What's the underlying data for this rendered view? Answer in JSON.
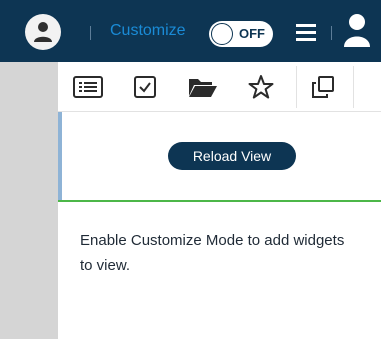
{
  "header": {
    "customize_label": "Customize",
    "toggle_state": "OFF",
    "colors": {
      "bar": "#0d3553",
      "accent": "#1a8bd6"
    }
  },
  "toolbar": {
    "icons": [
      "list-icon",
      "checkbox-icon",
      "folder-open-icon",
      "star-icon",
      "copy-icon"
    ]
  },
  "reload": {
    "label": "Reload View"
  },
  "content": {
    "message": "Enable Customize Mode to add widgets to view."
  }
}
